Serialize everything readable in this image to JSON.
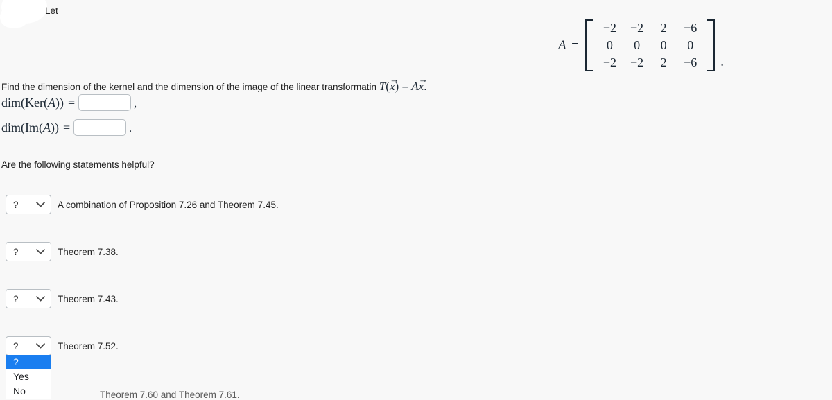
{
  "page": {
    "background_color": "#f8f8f8",
    "intro_text": "Let",
    "prompt_text": "Find the dimension of the kernel and the dimension of the image of the linear transformatin",
    "helpful_question": "Are the following statements helpful?",
    "clipped_bottom_text": "Theorem 7.60 and Theorem 7.61."
  },
  "matrix": {
    "name": "A",
    "equals": "=",
    "trailing_punct": ".",
    "rows": [
      [
        "−2",
        "−2",
        "2",
        "−6"
      ],
      [
        "0",
        "0",
        "0",
        "0"
      ],
      [
        "−2",
        "−2",
        "2",
        "−6"
      ]
    ]
  },
  "transformation": {
    "T": "T",
    "open_paren": "(",
    "x_var": "x",
    "close_paren": ")",
    "equals": "=",
    "A_var": "A",
    "x_var2": "x",
    "period": "."
  },
  "answers": [
    {
      "id": "ker",
      "label_prefix": "dim(Ker(",
      "label_var": "A",
      "label_suffix": "))",
      "equals": "=",
      "value": "",
      "placeholder": "",
      "punct": ","
    },
    {
      "id": "im",
      "label_prefix": "dim(Im(",
      "label_var": "A",
      "label_suffix": "))",
      "equals": "=",
      "value": "",
      "placeholder": "",
      "punct": "."
    }
  ],
  "statements": [
    {
      "selected": "?",
      "text": "A combination of Proposition 7.26 and Theorem 7.45."
    },
    {
      "selected": "?",
      "text": "Theorem 7.38."
    },
    {
      "selected": "?",
      "text": "Theorem 7.43."
    },
    {
      "selected": "?",
      "text": "Theorem 7.52."
    }
  ],
  "dropdown": {
    "open_for_index": 3,
    "highlight_color": "#1a7ef0",
    "options": [
      "?",
      "Yes",
      "No"
    ],
    "selected_option": "?"
  },
  "icons": {
    "chevron_down": "chevron-down-icon"
  }
}
